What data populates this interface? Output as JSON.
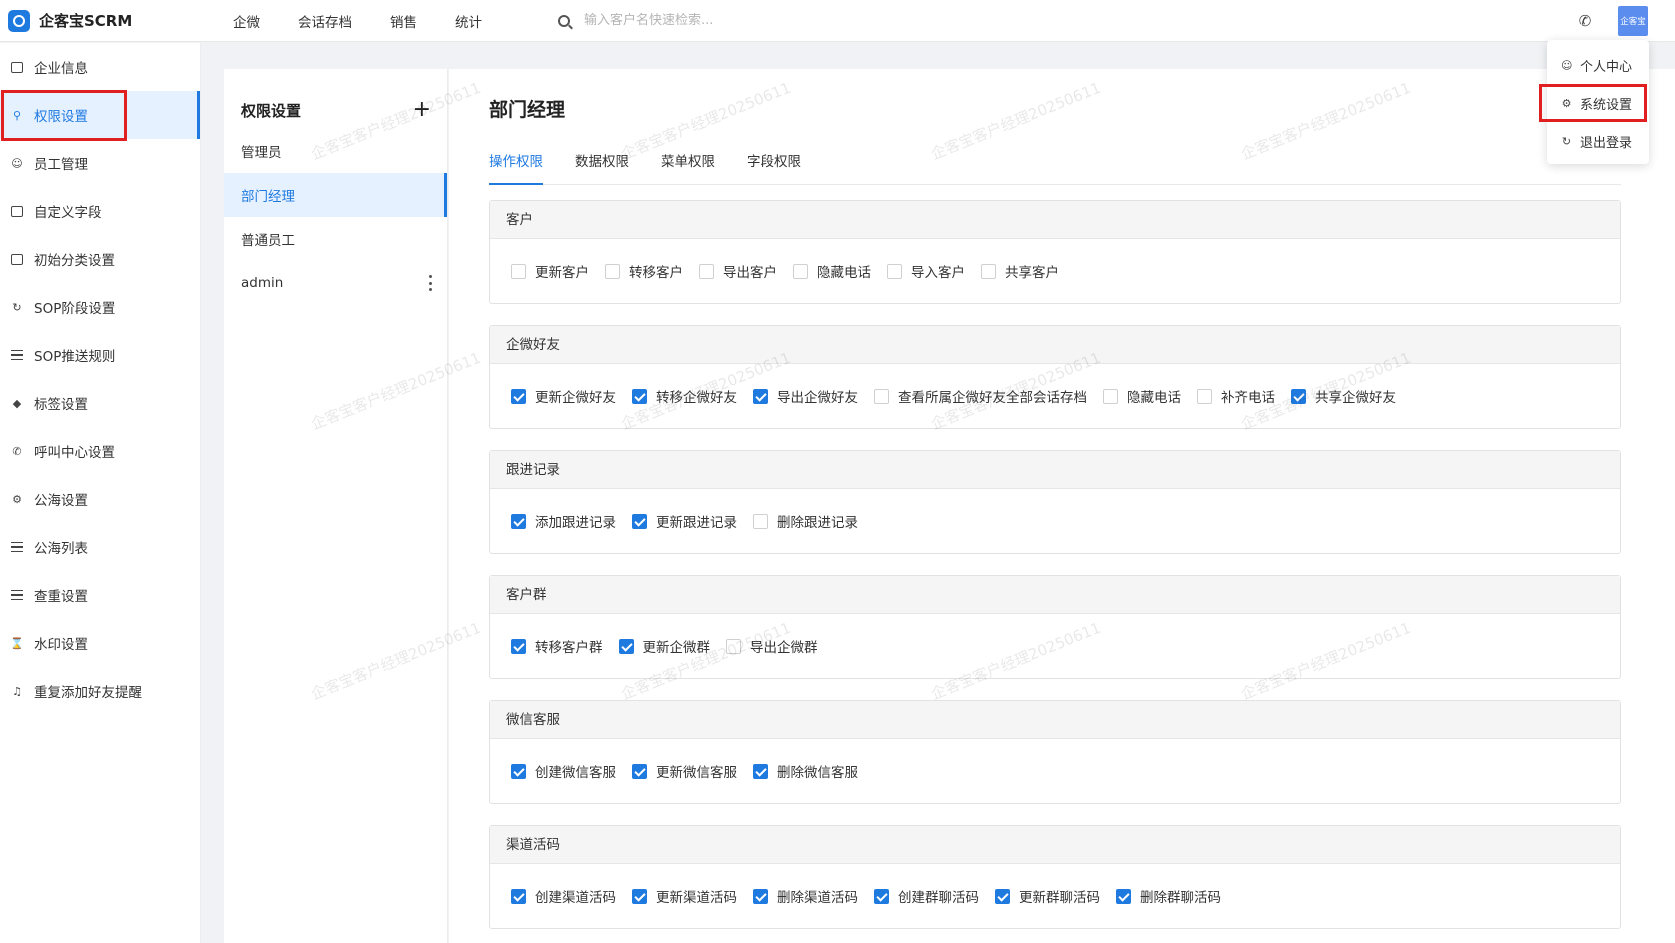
{
  "app": {
    "name": "企客宝SCRM"
  },
  "topnav": {
    "items": [
      "企微",
      "会话存档",
      "销售",
      "统计"
    ]
  },
  "search": {
    "placeholder": "输入客户名快速检索..."
  },
  "avatar": {
    "label": "企客宝"
  },
  "sidebar": {
    "items": [
      {
        "label": "企业信息",
        "icon": "calendar-icon"
      },
      {
        "label": "权限设置",
        "icon": "key-icon"
      },
      {
        "label": "员工管理",
        "icon": "user-icon"
      },
      {
        "label": "自定义字段",
        "icon": "form-icon"
      },
      {
        "label": "初始分类设置",
        "icon": "square-icon"
      },
      {
        "label": "SOP阶段设置",
        "icon": "workflow-icon"
      },
      {
        "label": "SOP推送规则",
        "icon": "list-icon"
      },
      {
        "label": "标签设置",
        "icon": "tag-icon"
      },
      {
        "label": "呼叫中心设置",
        "icon": "phone-icon"
      },
      {
        "label": "公海设置",
        "icon": "gear-icon"
      },
      {
        "label": "公海列表",
        "icon": "list-icon"
      },
      {
        "label": "查重设置",
        "icon": "list-icon"
      },
      {
        "label": "水印设置",
        "icon": "hourglass-icon"
      },
      {
        "label": "重复添加好友提醒",
        "icon": "bell-icon"
      }
    ],
    "active_index": 1
  },
  "roles": {
    "title": "权限设置",
    "items": [
      "管理员",
      "部门经理",
      "普通员工",
      "admin"
    ],
    "active_index": 1
  },
  "main": {
    "title": "部门经理",
    "tabs": [
      "操作权限",
      "数据权限",
      "菜单权限",
      "字段权限"
    ],
    "active_tab": 0,
    "groups": [
      {
        "title": "客户",
        "perms": [
          {
            "label": "更新客户",
            "checked": false
          },
          {
            "label": "转移客户",
            "checked": false
          },
          {
            "label": "导出客户",
            "checked": false
          },
          {
            "label": "隐藏电话",
            "checked": false
          },
          {
            "label": "导入客户",
            "checked": false
          },
          {
            "label": "共享客户",
            "checked": false
          }
        ]
      },
      {
        "title": "企微好友",
        "perms": [
          {
            "label": "更新企微好友",
            "checked": true
          },
          {
            "label": "转移企微好友",
            "checked": true
          },
          {
            "label": "导出企微好友",
            "checked": true
          },
          {
            "label": "查看所属企微好友全部会话存档",
            "checked": false
          },
          {
            "label": "隐藏电话",
            "checked": false
          },
          {
            "label": "补齐电话",
            "checked": false
          },
          {
            "label": "共享企微好友",
            "checked": true
          }
        ]
      },
      {
        "title": "跟进记录",
        "perms": [
          {
            "label": "添加跟进记录",
            "checked": true
          },
          {
            "label": "更新跟进记录",
            "checked": true
          },
          {
            "label": "删除跟进记录",
            "checked": false
          }
        ]
      },
      {
        "title": "客户群",
        "perms": [
          {
            "label": "转移客户群",
            "checked": true
          },
          {
            "label": "更新企微群",
            "checked": true
          },
          {
            "label": "导出企微群",
            "checked": false
          }
        ]
      },
      {
        "title": "微信客服",
        "perms": [
          {
            "label": "创建微信客服",
            "checked": true
          },
          {
            "label": "更新微信客服",
            "checked": true
          },
          {
            "label": "删除微信客服",
            "checked": true
          }
        ]
      },
      {
        "title": "渠道活码",
        "perms": [
          {
            "label": "创建渠道活码",
            "checked": true
          },
          {
            "label": "更新渠道活码",
            "checked": true
          },
          {
            "label": "删除渠道活码",
            "checked": true
          },
          {
            "label": "创建群聊活码",
            "checked": true
          },
          {
            "label": "更新群聊活码",
            "checked": true
          },
          {
            "label": "删除群聊活码",
            "checked": true
          }
        ]
      }
    ]
  },
  "user_menu": {
    "items": [
      {
        "label": "个人中心",
        "icon": "user-icon"
      },
      {
        "label": "系统设置",
        "icon": "gear-icon"
      },
      {
        "label": "退出登录",
        "icon": "logout-icon"
      }
    ]
  },
  "watermark": {
    "text": "企客宝客户经理20250611"
  },
  "colors": {
    "accent": "#1f7ae0",
    "highlight": "#e02020",
    "checkbox_on": "#1f7ae0"
  }
}
